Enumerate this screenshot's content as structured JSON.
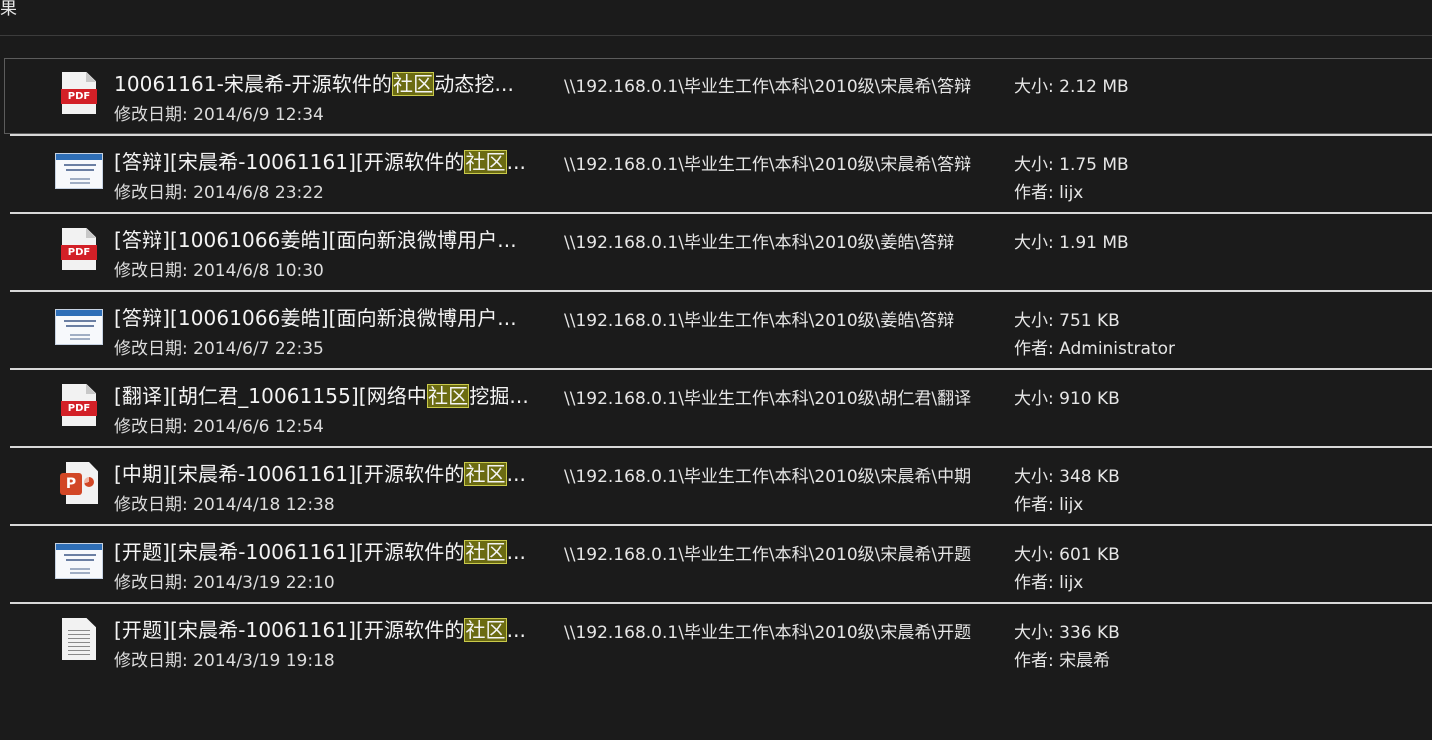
{
  "header": {
    "cut_text": "果"
  },
  "results": [
    {
      "icon": "pdf-icon",
      "title_pre": "10061161-宋晨希-开源软件的",
      "title_hl": "社区",
      "title_post": "动态挖...",
      "date": "修改日期: 2014/6/9 12:34",
      "path": "\\\\192.168.0.1\\毕业生工作\\本科\\2010级\\宋晨希\\答辩",
      "size": "大小: 2.12 MB",
      "author": ""
    },
    {
      "icon": "document-thumbnail-icon",
      "title_pre": "[答辩][宋晨希-10061161][开源软件的",
      "title_hl": "社区",
      "title_post": "...",
      "date": "修改日期: 2014/6/8 23:22",
      "path": "\\\\192.168.0.1\\毕业生工作\\本科\\2010级\\宋晨希\\答辩",
      "size": "大小: 1.75 MB",
      "author": "作者: lijx"
    },
    {
      "icon": "pdf-icon",
      "title_pre": "[答辩][10061066姜皓][面向新浪微博用户...",
      "title_hl": "",
      "title_post": "",
      "date": "修改日期: 2014/6/8 10:30",
      "path": "\\\\192.168.0.1\\毕业生工作\\本科\\2010级\\姜皓\\答辩",
      "size": "大小: 1.91 MB",
      "author": ""
    },
    {
      "icon": "document-thumbnail-icon",
      "title_pre": "[答辩][10061066姜皓][面向新浪微博用户...",
      "title_hl": "",
      "title_post": "",
      "date": "修改日期: 2014/6/7 22:35",
      "path": "\\\\192.168.0.1\\毕业生工作\\本科\\2010级\\姜皓\\答辩",
      "size": "大小: 751 KB",
      "author": "作者: Administrator"
    },
    {
      "icon": "pdf-icon",
      "title_pre": "[翻译][胡仁君_10061155][网络中",
      "title_hl": "社区",
      "title_post": "挖掘...",
      "date": "修改日期: 2014/6/6 12:54",
      "path": "\\\\192.168.0.1\\毕业生工作\\本科\\2010级\\胡仁君\\翻译",
      "size": "大小: 910 KB",
      "author": ""
    },
    {
      "icon": "powerpoint-icon",
      "title_pre": "[中期][宋晨希-10061161][开源软件的",
      "title_hl": "社区",
      "title_post": "...",
      "date": "修改日期: 2014/4/18 12:38",
      "path": "\\\\192.168.0.1\\毕业生工作\\本科\\2010级\\宋晨希\\中期",
      "size": "大小: 348 KB",
      "author": "作者: lijx"
    },
    {
      "icon": "document-thumbnail-icon",
      "title_pre": "[开题][宋晨希-10061161][开源软件的",
      "title_hl": "社区",
      "title_post": "...",
      "date": "修改日期: 2014/3/19 22:10",
      "path": "\\\\192.168.0.1\\毕业生工作\\本科\\2010级\\宋晨希\\开题",
      "size": "大小: 601 KB",
      "author": "作者: lijx"
    },
    {
      "icon": "text-document-icon",
      "title_pre": "[开题][宋晨希-10061161][开源软件的",
      "title_hl": "社区",
      "title_post": "...",
      "date": "修改日期: 2014/3/19 19:18",
      "path": "\\\\192.168.0.1\\毕业生工作\\本科\\2010级\\宋晨希\\开题",
      "size": "大小: 336 KB",
      "author": "作者: 宋晨希"
    }
  ],
  "colors": {
    "background": "#1b1b1b",
    "highlight": "#6b6b12",
    "pdf_red": "#d32027",
    "ppt_orange": "#d24726"
  }
}
